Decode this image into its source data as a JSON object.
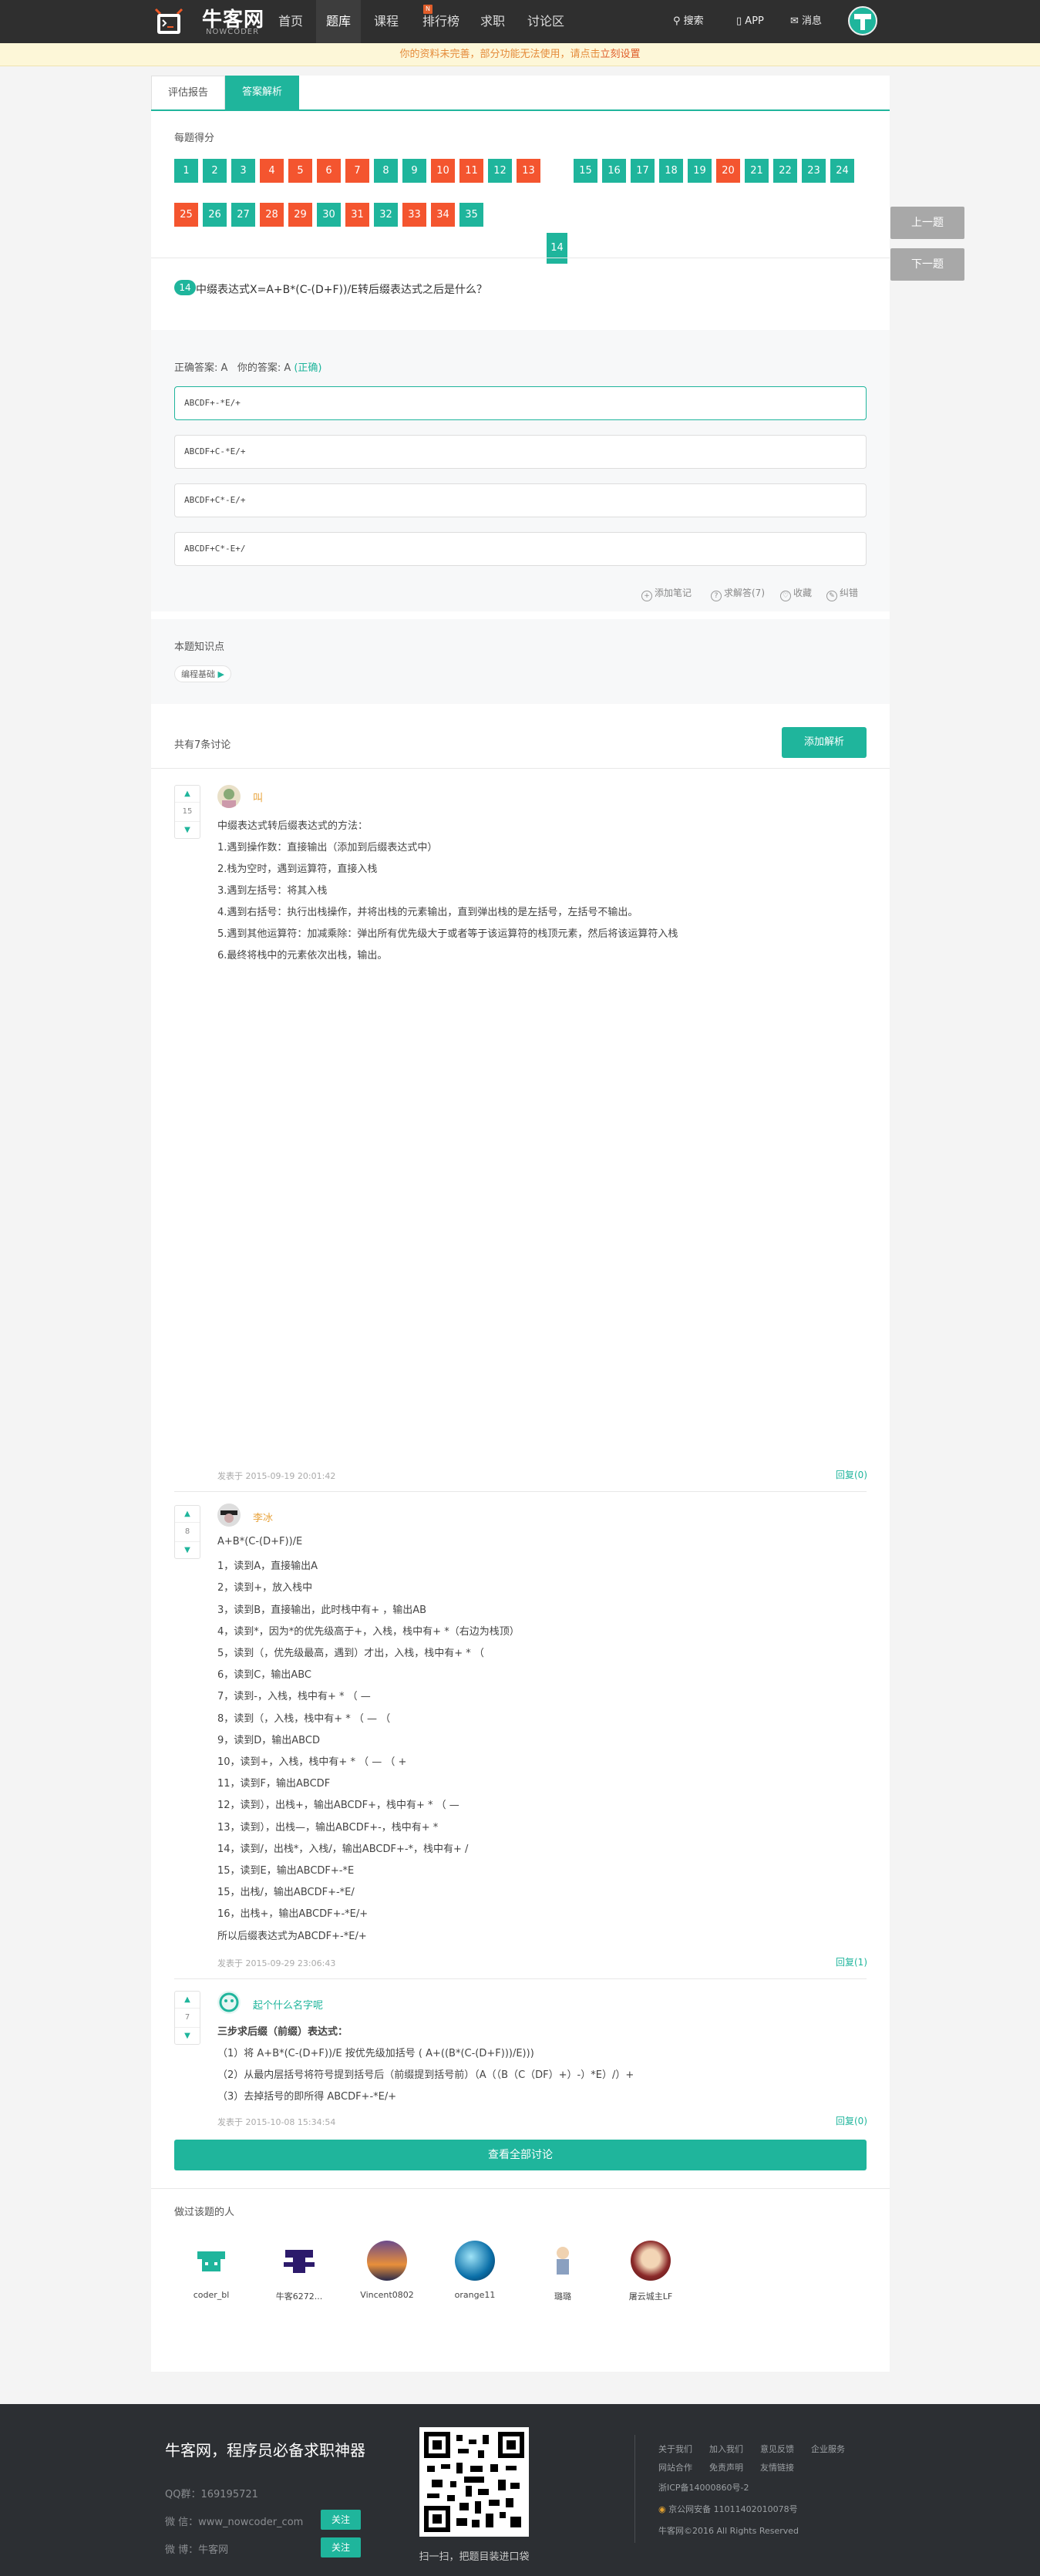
{
  "nav": {
    "logo_title": "牛客网",
    "logo_sub": "NOWCODER",
    "items": [
      "首页",
      "题库",
      "课程",
      "排行榜",
      "求职",
      "讨论区"
    ],
    "search": "搜索",
    "app": "APP",
    "messages": "消息"
  },
  "notice": {
    "text": "你的资料未完善，部分功能无法使用，请点击",
    "link": "立刻设置"
  },
  "tabs": [
    "评估报告",
    "答案解析"
  ],
  "score": {
    "title": "每题得分",
    "row1": [
      "1",
      "2",
      "3",
      "4",
      "5",
      "6",
      "7",
      "8",
      "9",
      "10",
      "11",
      "12",
      "13",
      "14",
      "15",
      "16",
      "17",
      "18",
      "19",
      "20",
      "21",
      "22",
      "23",
      "24"
    ],
    "row2": [
      "25",
      "26",
      "27",
      "28",
      "29",
      "30",
      "31",
      "32",
      "33",
      "34",
      "35"
    ]
  },
  "side": {
    "prev": "上一题",
    "next": "下一题"
  },
  "question": {
    "num": "14",
    "text": "中缀表达式X=A+B*(C-(D+F))/E转后缀表达式之后是什么？"
  },
  "answer": {
    "correct_label": "正确答案: A",
    "yours_label": "你的答案: A",
    "status": "(正确)"
  },
  "options": [
    "ABCDF+-*E/+",
    "ABCDF+C-*E/+",
    "ABCDF+C*-E/+",
    "ABCDF+C*-E+/"
  ],
  "tools": [
    "添加笔记",
    "求解答(7)",
    "收藏",
    "纠错"
  ],
  "knowledge": {
    "title": "本题知识点",
    "tag": "编程基础"
  },
  "discuss": {
    "count": "共有7条讨论",
    "add": "添加解析"
  },
  "comments": [
    {
      "votes": "15",
      "name": "叫",
      "lines": [
        "中缀表达式转后缀表达式的方法：",
        "1.遇到操作数：直接输出（添加到后缀表达式中）",
        "2.栈为空时，遇到运算符，直接入栈",
        "3.遇到左括号：将其入栈",
        "4.遇到右括号：执行出栈操作，并将出栈的元素输出，直到弹出栈的是左括号，左括号不输出。",
        "5.遇到其他运算符：加减乘除：弹出所有优先级大于或者等于该运算符的栈顶元素，然后将该运算符入栈",
        "6.最终将栈中的元素依次出栈，输出。"
      ],
      "time": "发表于 2015-09-19 20:01:42",
      "reply": "回复(0)"
    },
    {
      "votes": "8",
      "name": "李冰",
      "lines": [
        "A+B*(C-(D+F))/E",
        "1，读到A，直接输出A",
        "2，读到+，放入栈中",
        "3，读到B，直接输出，此时栈中有+ ，输出AB",
        "4，读到*，因为*的优先级高于+，入栈，栈中有+ *（右边为栈顶）",
        "5，读到（，优先级最高，遇到）才出，入栈，栈中有+ * （",
        "6，读到C，输出ABC",
        "7，读到-，入栈，栈中有+ * （ —",
        "8，读到（，入栈，栈中有+ * （ — （",
        "9，读到D，输出ABCD",
        "10，读到+，入栈，栈中有+ * （ — （ +",
        "11，读到F，输出ABCDF",
        "12，读到），出栈+，输出ABCDF+，栈中有+ * （ —",
        "13，读到），出栈—，输出ABCDF+-，栈中有+ *",
        "14，读到/，出栈*，入栈/，输出ABCDF+-*，栈中有+ /",
        "15，读到E，输出ABCDF+-*E",
        "15，出栈/，输出ABCDF+-*E/",
        "16，出栈+，输出ABCDF+-*E/+",
        "所以后缀表达式为ABCDF+-*E/+"
      ],
      "time": "发表于 2015-09-29 23:06:43",
      "reply": "回复(1)"
    },
    {
      "votes": "7",
      "name": "起个什么名字呢",
      "lines": [
        "三步求后缀（前缀）表达式：",
        "（1）将 A+B*(C-(D+F))/E 按优先级加括号 ( A+((B*(C-(D+F)))/E)))",
        "（2）从最内层括号将符号提到括号后（前缀提到括号前）（A（（B（C（DF）+）-）*E）/）+",
        "（3）去掉括号的即所得 ABCDF+-*E/+"
      ],
      "time": "发表于 2015-10-08 15:34:54",
      "reply": "回复(0)"
    }
  ],
  "see_all": "查看全部讨论",
  "also": {
    "title": "做过该题的人",
    "people": [
      "coder_bl",
      "牛客6272...",
      "Vincent0802",
      "orange11",
      "璐璐",
      "屠云城主LF"
    ]
  },
  "footer": {
    "title": "牛客网，程序员必备求职神器",
    "qq": "QQ群：169195721",
    "wechat": "微 信：www_nowcoder_com",
    "weibo": "微 博：牛客网",
    "follow": "关注",
    "qr_caption": "扫一扫，把题目装进口袋",
    "links1": [
      "关于我们",
      "加入我们",
      "意见反馈",
      "企业服务"
    ],
    "links2": [
      "网站合作",
      "免责声明",
      "友情链接"
    ],
    "icp": "浙ICP备14000860号-2",
    "police": "京公网安备 11011402010078号",
    "copy": "牛客网©2016 All Rights Reserved"
  },
  "colors": {
    "accent": "#1fb59c",
    "wrong": "#f4552f",
    "nav_bg": "#2f2f2f"
  }
}
